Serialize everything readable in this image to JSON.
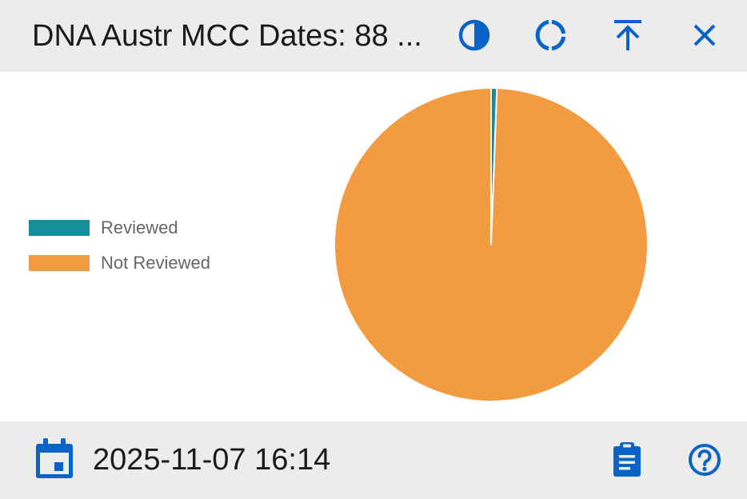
{
  "header": {
    "title": "DNA Austr MCC Dates: 88 ...",
    "icons": [
      "contrast-icon",
      "donut-icon",
      "expand-to-top-icon",
      "close-icon"
    ]
  },
  "colors": {
    "accent": "#0a64c8",
    "reviewed": "#138f9a",
    "not_reviewed": "#f29b40",
    "header_bg": "#ececec"
  },
  "chart_data": {
    "type": "pie",
    "categories": [
      "Reviewed",
      "Not Reviewed"
    ],
    "values": [
      0.6,
      99.4
    ],
    "colors": [
      "#138f9a",
      "#f29b40"
    ],
    "legend_placement": "left"
  },
  "footer": {
    "timestamp": "2025-11-07 16:14",
    "icons": [
      "calendar-icon",
      "clipboard-icon",
      "help-icon"
    ]
  }
}
